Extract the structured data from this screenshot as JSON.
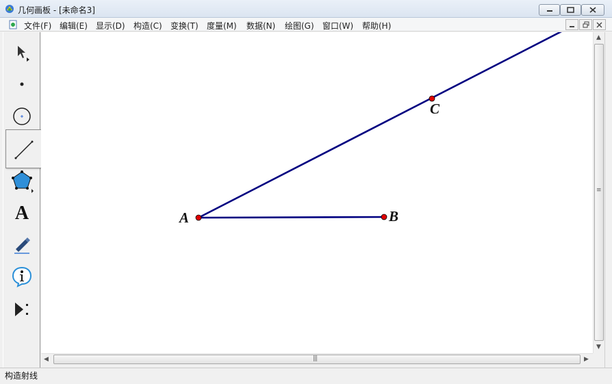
{
  "window": {
    "title": "几何画板 - [未命名3]"
  },
  "menu": {
    "items": [
      {
        "label": "文件(F)"
      },
      {
        "label": "编辑(E)"
      },
      {
        "label": "显示(D)"
      },
      {
        "label": "构造(C)"
      },
      {
        "label": "变换(T)"
      },
      {
        "label": "度量(M)"
      },
      {
        "label": "数据(N)"
      },
      {
        "label": "绘图(G)"
      },
      {
        "label": "窗口(W)"
      },
      {
        "label": "帮助(H)"
      }
    ]
  },
  "toolbar": {
    "tools": [
      {
        "icon": "arrow-select-icon"
      },
      {
        "icon": "point-tool-icon"
      },
      {
        "icon": "compass-circle-icon"
      },
      {
        "icon": "straightedge-icon"
      },
      {
        "icon": "polygon-tool-icon"
      },
      {
        "icon": "text-tool-icon",
        "text": "A"
      },
      {
        "icon": "marker-pen-icon"
      },
      {
        "icon": "information-icon"
      },
      {
        "icon": "custom-tool-icon"
      }
    ],
    "flyout": {
      "selected": "ray",
      "options": [
        {
          "icon": "segment-tool-icon"
        },
        {
          "icon": "line-tool-icon"
        },
        {
          "icon": "ray-tool-icon"
        },
        {
          "icon": "double-arrow-line-icon"
        }
      ]
    }
  },
  "canvas": {
    "points": [
      {
        "label": "A"
      },
      {
        "label": "B"
      },
      {
        "label": "C"
      }
    ],
    "colors": {
      "line": "#000080",
      "point": "#e00000"
    }
  },
  "status": {
    "text": "构造射线"
  }
}
